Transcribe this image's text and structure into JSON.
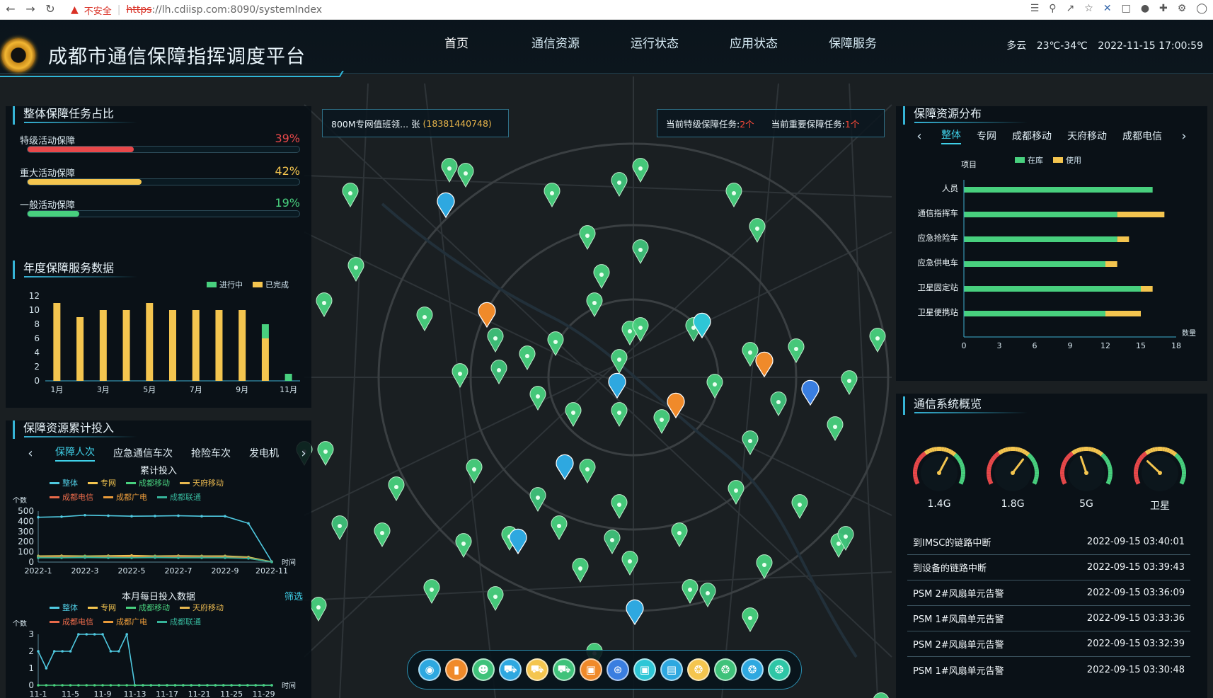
{
  "browser": {
    "insecure_label": "不安全",
    "url_scheme": "https",
    "url_rest": "://lh.cdiisp.com:8090/systemIndex"
  },
  "header": {
    "title": "成都市通信保障指挥调度平台",
    "nav": [
      "首页",
      "通信资源",
      "运行状态",
      "应用状态",
      "保障服务"
    ],
    "weather": "多云",
    "temperature": "23℃-34℃",
    "datetime": "2022-11-15 17:00:59"
  },
  "task_share": {
    "title": "整体保障任务占比",
    "items": [
      {
        "name": "特级活动保障",
        "value": "39%",
        "pct": 39,
        "color": "#e8484a"
      },
      {
        "name": "重大活动保障",
        "value": "42%",
        "pct": 42,
        "color": "#f4c54f"
      },
      {
        "name": "一般活动保障",
        "value": "19%",
        "pct": 19,
        "color": "#48d07e"
      }
    ]
  },
  "annual": {
    "title": "年度保障服务数据",
    "legend": [
      "进行中",
      "已完成"
    ]
  },
  "resource_input": {
    "title": "保障资源累计投入",
    "tabs": [
      "保障人次",
      "应急通信车次",
      "抢险车次",
      "发电机"
    ],
    "chart1_title": "累计投入",
    "chart2_title": "本月每日投入数据",
    "filter_label": "筛选",
    "legend": [
      "整体",
      "专网",
      "成都移动",
      "天府移动",
      "成都电信",
      "成都广电",
      "成都联通"
    ]
  },
  "pills": {
    "duty": "800M专网值班领... 张",
    "phone": "(18381440748)",
    "special_label": "当前特级保障任务:",
    "special_value": "2个",
    "major_label": "当前重要保障任务:",
    "major_value": "1个"
  },
  "resource_dist": {
    "title": "保障资源分布",
    "tabs": [
      "整体",
      "专网",
      "成都移动",
      "天府移动",
      "成都电信"
    ],
    "legend": [
      "在库",
      "使用"
    ],
    "col_header": "项目"
  },
  "comm": {
    "title": "通信系统概览",
    "gauges": [
      {
        "label": "1.4G",
        "value": 0.62
      },
      {
        "label": "1.8G",
        "value": 0.66
      },
      {
        "label": "5G",
        "value": 0.42
      },
      {
        "label": "卫星",
        "value": 0.3
      }
    ],
    "alarms": [
      {
        "text": "到IMSC的链路中断",
        "time": "2022-09-15 03:40:01"
      },
      {
        "text": "到设备的链路中断",
        "time": "2022-09-15 03:39:43"
      },
      {
        "text": "PSM 2#风扇单元告警",
        "time": "2022-09-15 03:36:09"
      },
      {
        "text": "PSM 1#风扇单元告警",
        "time": "2022-09-15 03:33:36"
      },
      {
        "text": "PSM 2#风扇单元告警",
        "time": "2022-09-15 03:32:39"
      },
      {
        "text": "PSM 1#风扇单元告警",
        "time": "2022-09-15 03:30:48"
      }
    ]
  },
  "toolbar_icons": [
    "location-icon",
    "station-icon",
    "person-icon",
    "vehicle-icon",
    "truck-icon",
    "van-icon",
    "tower-box-icon",
    "signal-icon",
    "screen-icon",
    "book-icon",
    "antenna-icon",
    "antenna-green-icon",
    "antenna-cyan-icon",
    "antenna-teal-icon"
  ],
  "chart_data": [
    {
      "type": "bar",
      "categories": [
        "1月",
        "2月",
        "3月",
        "4月",
        "5月",
        "6月",
        "7月",
        "8月",
        "9月",
        "10月",
        "11月"
      ],
      "tick_labels": [
        "1月",
        "3月",
        "5月",
        "7月",
        "9月",
        "11月"
      ],
      "series": [
        {
          "name": "进行中",
          "values": [
            0,
            0,
            0,
            0,
            0,
            0,
            0,
            0,
            0,
            2,
            1
          ]
        },
        {
          "name": "已完成",
          "values": [
            11,
            9,
            10,
            10,
            11,
            10,
            10,
            10,
            10,
            6,
            0
          ]
        }
      ],
      "ylim": [
        0,
        12
      ],
      "yticks": [
        0,
        2,
        4,
        6,
        8,
        10,
        12
      ]
    },
    {
      "type": "line",
      "title": "累计投入",
      "xlabel": "时间",
      "ylabel": "个数",
      "x": [
        "2022-1",
        "2022-2",
        "2022-3",
        "2022-4",
        "2022-5",
        "2022-6",
        "2022-7",
        "2022-8",
        "2022-9",
        "2022-10",
        "2022-11"
      ],
      "tick_labels": [
        "2022-1",
        "2022-3",
        "2022-5",
        "2022-7",
        "2022-9",
        "2022-11"
      ],
      "ylim": [
        0,
        500
      ],
      "yticks": [
        0,
        100,
        200,
        300,
        400,
        500
      ],
      "series": [
        {
          "name": "整体",
          "color": "#4fc9e0",
          "values": [
            440,
            445,
            460,
            455,
            450,
            452,
            455,
            450,
            450,
            380,
            5
          ]
        },
        {
          "name": "专网",
          "color": "#f4c54f",
          "values": [
            60,
            62,
            60,
            62,
            65,
            60,
            62,
            60,
            60,
            50,
            3
          ]
        },
        {
          "name": "成都移动",
          "color": "#48d07e",
          "values": [
            55,
            55,
            58,
            55,
            55,
            58,
            55,
            55,
            55,
            45,
            2
          ]
        },
        {
          "name": "天府移动",
          "color": "#e8b84f",
          "values": [
            50,
            52,
            50,
            50,
            55,
            52,
            50,
            50,
            52,
            42,
            2
          ]
        },
        {
          "name": "成都电信",
          "color": "#e86a4a",
          "values": [
            48,
            50,
            48,
            50,
            48,
            50,
            52,
            50,
            48,
            40,
            2
          ]
        },
        {
          "name": "成都广电",
          "color": "#e89a3a",
          "values": [
            45,
            45,
            46,
            45,
            45,
            46,
            45,
            45,
            45,
            38,
            1
          ]
        },
        {
          "name": "成都联通",
          "color": "#36b49a",
          "values": [
            42,
            42,
            44,
            42,
            42,
            44,
            42,
            42,
            42,
            36,
            1
          ]
        }
      ]
    },
    {
      "type": "line",
      "title": "本月每日投入数据",
      "xlabel": "时间",
      "ylabel": "个数",
      "x": [
        "11-1",
        "11-2",
        "11-3",
        "11-4",
        "11-5",
        "11-6",
        "11-7",
        "11-8",
        "11-9",
        "11-10",
        "11-11",
        "11-12",
        "11-13",
        "11-14",
        "11-15",
        "11-16",
        "11-17",
        "11-18",
        "11-19",
        "11-20",
        "11-21",
        "11-22",
        "11-23",
        "11-24",
        "11-25",
        "11-26",
        "11-27",
        "11-28",
        "11-29",
        "11-30"
      ],
      "tick_labels": [
        "11-1",
        "11-5",
        "11-9",
        "11-13",
        "11-17",
        "11-21",
        "11-25",
        "11-29"
      ],
      "ylim": [
        0,
        3
      ],
      "yticks": [
        0,
        1,
        2,
        3
      ],
      "series": [
        {
          "name": "整体",
          "color": "#4fc9e0",
          "values": [
            2,
            1,
            2,
            2,
            2,
            3,
            3,
            3,
            3,
            2,
            2,
            3,
            0,
            0,
            0,
            0,
            0,
            0,
            0,
            0,
            0,
            0,
            0,
            0,
            0,
            0,
            0,
            0,
            0,
            0
          ]
        },
        {
          "name": "成都移动",
          "color": "#48d07e",
          "values": [
            0,
            0,
            0,
            0,
            0,
            0,
            0,
            0,
            0,
            0,
            0,
            0,
            0,
            0,
            0,
            0,
            0,
            0,
            0,
            0,
            0,
            0,
            0,
            0,
            0,
            0,
            0,
            0,
            0,
            0
          ]
        }
      ]
    },
    {
      "type": "bar",
      "orientation": "horizontal",
      "categories": [
        "人员",
        "通信指挥车",
        "应急抢险车",
        "应急供电车",
        "卫星固定站",
        "卫星便携站"
      ],
      "xlabel": "数量",
      "xlim": [
        0,
        18
      ],
      "xticks": [
        0,
        3,
        6,
        9,
        12,
        15,
        18
      ],
      "series": [
        {
          "name": "在库",
          "color": "#48d07e",
          "values": [
            16,
            13,
            13,
            12,
            15,
            12
          ]
        },
        {
          "name": "使用",
          "color": "#f4c54f",
          "values": [
            0,
            4,
            1,
            1,
            1,
            3
          ]
        }
      ]
    }
  ]
}
